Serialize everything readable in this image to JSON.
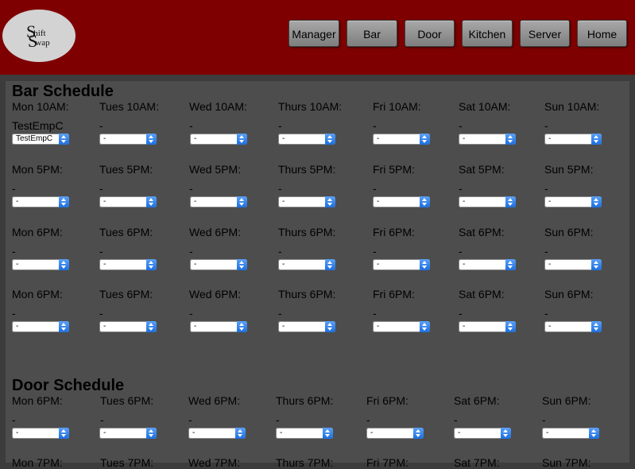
{
  "header": {
    "logo": {
      "line1_big": "S",
      "line1_small": "hift",
      "line2_big": "S",
      "line2_small": "wap"
    },
    "nav": [
      "Manager",
      "Bar",
      "Door",
      "Kitchen",
      "Server",
      "Home"
    ]
  },
  "bar": {
    "title": "Bar Schedule",
    "rows": [
      {
        "labels": [
          "Mon 10AM:",
          "Tues 10AM:",
          "Wed 10AM:",
          "Thurs 10AM:",
          "Fri 10AM:",
          "Sat 10AM:",
          "Sun 10AM:"
        ],
        "assigned": [
          "TestEmpC",
          "-",
          "-",
          "-",
          "-",
          "-",
          "-"
        ],
        "selected": [
          "TestEmpC",
          "-",
          "-",
          "-",
          "-",
          "-",
          "-"
        ]
      },
      {
        "labels": [
          "Mon 5PM:",
          "Tues 5PM:",
          "Wed 5PM:",
          "Thurs 5PM:",
          "Fri 5PM:",
          "Sat 5PM:",
          "Sun 5PM:"
        ],
        "assigned": [
          "-",
          "-",
          "-",
          "-",
          "-",
          "-",
          "-"
        ],
        "selected": [
          "-",
          "-",
          "-",
          "-",
          "-",
          "-",
          "-"
        ]
      },
      {
        "labels": [
          "Mon 6PM:",
          "Tues 6PM:",
          "Wed 6PM:",
          "Thurs 6PM:",
          "Fri 6PM:",
          "Sat 6PM:",
          "Sun 6PM:"
        ],
        "assigned": [
          "-",
          "-",
          "-",
          "-",
          "-",
          "-",
          "-"
        ],
        "selected": [
          "-",
          "-",
          "-",
          "-",
          "-",
          "-",
          "-"
        ]
      },
      {
        "labels": [
          "Mon 6PM:",
          "Tues 6PM:",
          "Wed 6PM:",
          "Thurs 6PM:",
          "Fri 6PM:",
          "Sat 6PM:",
          "Sun 6PM:"
        ],
        "assigned": [
          "-",
          "-",
          "-",
          "-",
          "-",
          "-",
          "-"
        ],
        "selected": [
          "-",
          "-",
          "-",
          "-",
          "-",
          "-",
          "-"
        ]
      }
    ]
  },
  "door": {
    "title": "Door Schedule",
    "rows": [
      {
        "labels": [
          "Mon 6PM:",
          "Tues 6PM:",
          "Wed 6PM:",
          "Thurs 6PM:",
          "Fri 6PM:",
          "Sat 6PM:",
          "Sun 6PM:"
        ],
        "assigned": [
          "-",
          "-",
          "-",
          "-",
          "-",
          "-",
          "-"
        ],
        "selected": [
          "-",
          "-",
          "-",
          "-",
          "-",
          "-",
          "-"
        ]
      },
      {
        "labels": [
          "Mon 7PM:",
          "Tues 7PM:",
          "Wed 7PM:",
          "Thurs 7PM:",
          "Fri 7PM:",
          "Sat 7PM:",
          "Sun 7PM:"
        ],
        "assigned": [],
        "selected": []
      }
    ]
  },
  "colors": {
    "header_bg": "#7f0000",
    "page_bg": "#3c3c3c",
    "panel_bg": "#4d4d4d",
    "select_accent": "#2f80ed"
  }
}
